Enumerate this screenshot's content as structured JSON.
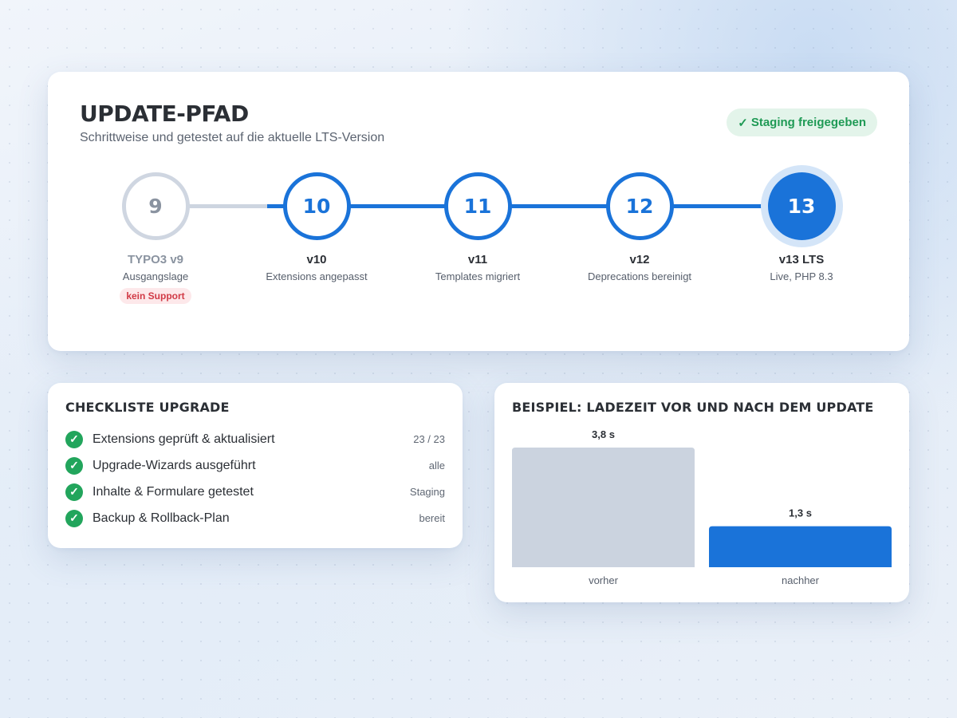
{
  "header": {
    "title": "UPDATE-PFAD",
    "subtitle": "Schrittweise und getestet auf die aktuelle LTS-Version",
    "status_icon": "check-icon",
    "status_label": "Staging freigegeben"
  },
  "steps": [
    {
      "number": "9",
      "label": "TYPO3 v9",
      "desc": "Ausgangslage",
      "badge": "kein Support",
      "state": "old"
    },
    {
      "number": "10",
      "label": "v10",
      "desc": "Extensions angepasst",
      "state": "done"
    },
    {
      "number": "11",
      "label": "v11",
      "desc": "Templates migriert",
      "state": "done"
    },
    {
      "number": "12",
      "label": "v12",
      "desc": "Deprecations bereinigt",
      "state": "done"
    },
    {
      "number": "13",
      "label": "v13 LTS",
      "desc": "Live, PHP 8.3",
      "state": "current"
    }
  ],
  "checklist": {
    "title": "CHECKLISTE UPGRADE",
    "items": [
      {
        "label": "Extensions geprüft & aktualisiert",
        "meta": "23 / 23"
      },
      {
        "label": "Upgrade-Wizards ausgeführt",
        "meta": "alle"
      },
      {
        "label": "Inhalte & Formulare getestet",
        "meta": "Staging"
      },
      {
        "label": "Backup & Rollback-Plan",
        "meta": "bereit"
      }
    ]
  },
  "chart_data": {
    "type": "bar",
    "title": "BEISPIEL: LADEZEIT VOR UND NACH DEM UPDATE",
    "categories": [
      "vorher",
      "nachher"
    ],
    "values": [
      3.8,
      1.3
    ],
    "value_labels": [
      "3,8 s",
      "1,3 s"
    ],
    "colors": [
      "#cbd3df",
      "#1a73d9"
    ],
    "ylim": [
      0,
      3.8
    ],
    "grid": false
  },
  "colors": {
    "accent": "#1a73d9",
    "success": "#22a55c",
    "warning": "#d13a46",
    "muted": "#cfd6e1"
  }
}
